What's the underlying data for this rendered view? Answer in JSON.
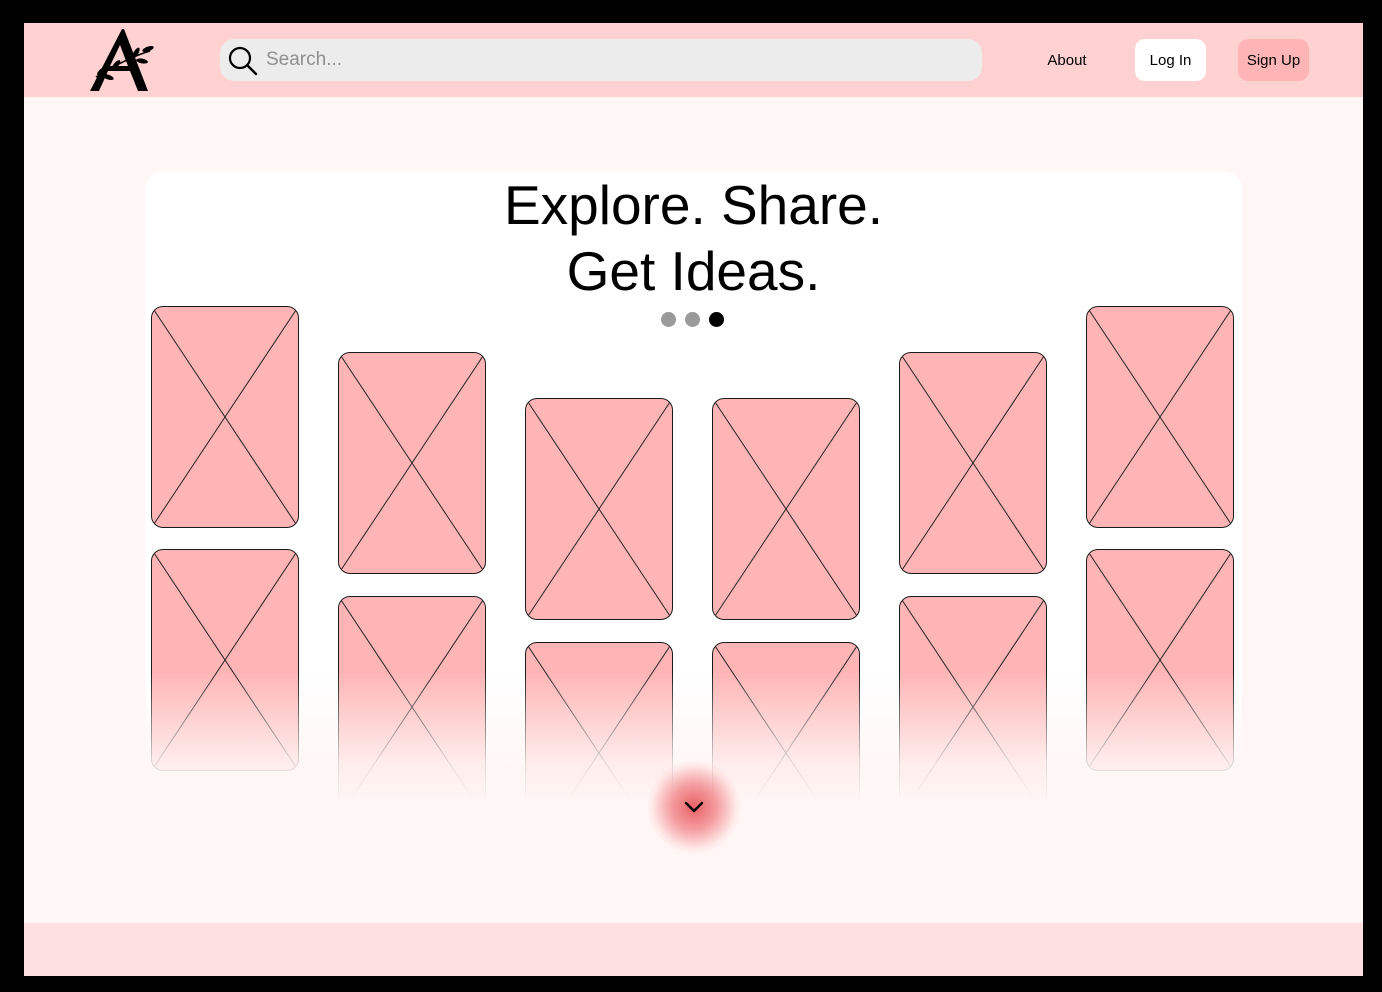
{
  "brand": {
    "logo_icon": "olive-branch-letter-a-logo"
  },
  "search": {
    "placeholder": "Search...",
    "icon": "search-icon"
  },
  "nav": {
    "about_label": "About",
    "login_label": "Log In",
    "signup_label": "Sign Up"
  },
  "hero": {
    "headline_line1": "Explore. Share.",
    "headline_line2": "Get Ideas.",
    "carousel": {
      "total": 3,
      "active_index": 3
    }
  },
  "scroll_button": {
    "icon": "chevron-down-icon"
  },
  "colors": {
    "header_bg": "#ffd1d1",
    "page_bg": "#fff6f5",
    "card_fill": "#ffb5b6",
    "signup_bg": "#ffb5b6",
    "accent": "#e85a5f"
  }
}
